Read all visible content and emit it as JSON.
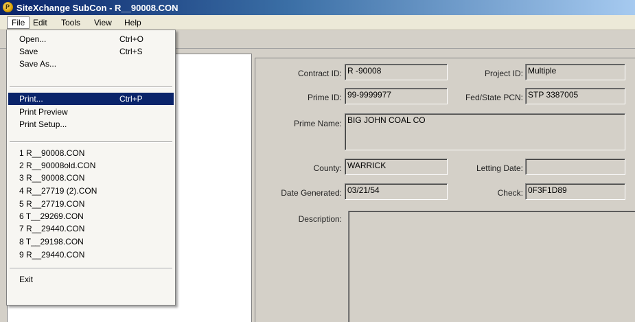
{
  "window": {
    "title": "SiteXchange SubCon - R__90008.CON"
  },
  "menubar": {
    "file": "File",
    "edit": "Edit",
    "tools": "Tools",
    "view": "View",
    "help": "Help"
  },
  "file_menu": {
    "open": {
      "label": "Open...",
      "shortcut": "Ctrl+O"
    },
    "save": {
      "label": "Save",
      "shortcut": "Ctrl+S"
    },
    "save_as": {
      "label": "Save As..."
    },
    "print": {
      "label": "Print...",
      "shortcut": "Ctrl+P"
    },
    "print_preview": {
      "label": "Print Preview"
    },
    "print_setup": {
      "label": "Print Setup..."
    },
    "recent": [
      "1 R__90008.CON",
      "2 R__90008old.CON",
      "3 R__90008.CON",
      "4 R__27719 (2).CON",
      "5 R__27719.CON",
      "6 T__29269.CON",
      "7 R__29440.CON",
      "8 T__29198.CON",
      "9 R__29440.CON"
    ],
    "exit": {
      "label": "Exit"
    }
  },
  "form": {
    "contract_id": {
      "label": "Contract ID:",
      "value": "R -90008"
    },
    "project_id": {
      "label": "Project ID:",
      "value": "Multiple"
    },
    "prime_id": {
      "label": "Prime ID:",
      "value": "99-9999977"
    },
    "fed_state_pcn": {
      "label": "Fed/State PCN:",
      "value": "STP 3387005"
    },
    "prime_name": {
      "label": "Prime Name:",
      "value": "BIG JOHN COAL CO"
    },
    "county": {
      "label": "County:",
      "value": "WARRICK"
    },
    "letting_date": {
      "label": "Letting Date:",
      "value": ""
    },
    "date_generated": {
      "label": "Date Generated:",
      "value": "03/21/54"
    },
    "check": {
      "label": "Check:",
      "value": "0F3F1D89"
    },
    "description": {
      "label": "Description:",
      "value": ""
    }
  }
}
